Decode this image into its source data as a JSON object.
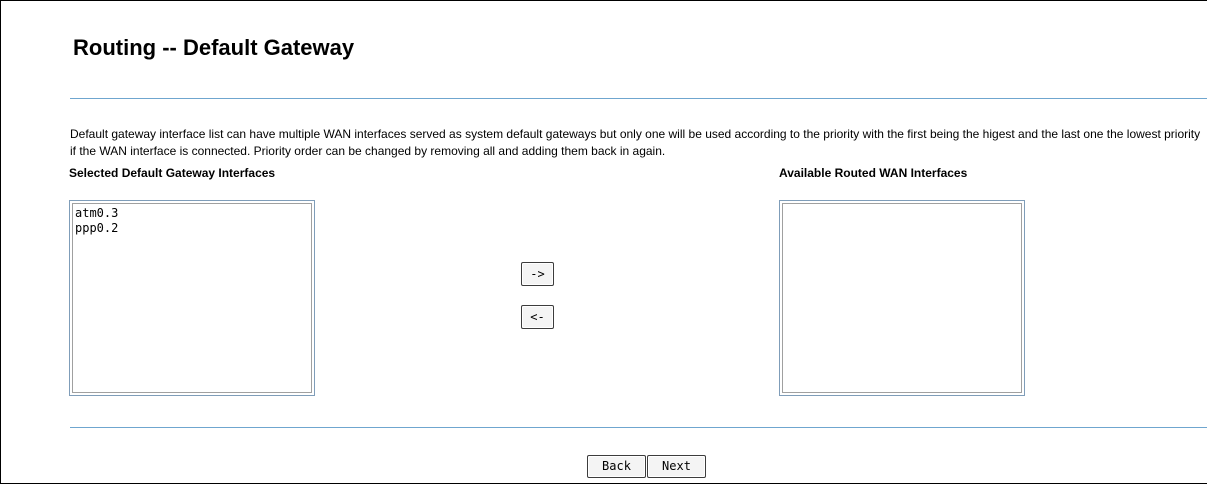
{
  "page": {
    "title": "Routing -- Default Gateway",
    "description": "Default gateway interface list can have multiple WAN interfaces served as system default gateways but only one will be used according to the priority with the first being the higest and the last one the lowest priority if the WAN interface is connected. Priority order can be changed by removing all and adding them back in again."
  },
  "selected_list": {
    "heading": "Selected Default Gateway Interfaces",
    "items": [
      "atm0.3",
      "ppp0.2"
    ]
  },
  "available_list": {
    "heading": "Available Routed WAN Interfaces",
    "items": []
  },
  "move_buttons": {
    "right_label": "->",
    "left_label": "<-"
  },
  "footer": {
    "back_label": "Back",
    "next_label": "Next"
  }
}
